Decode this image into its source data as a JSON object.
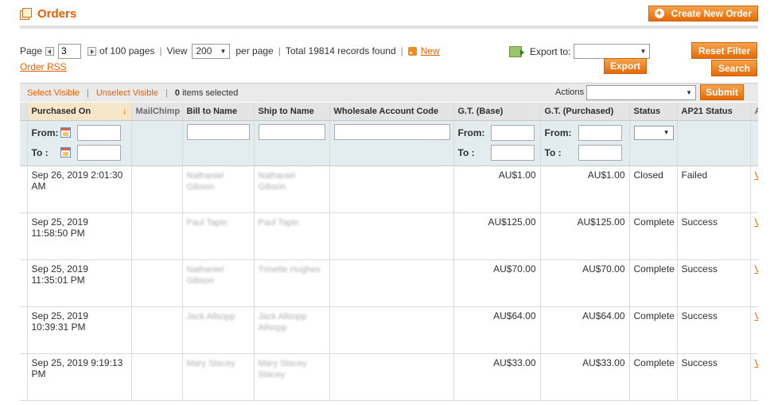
{
  "header": {
    "title": "Orders",
    "create_label": "Create New Order"
  },
  "pager": {
    "page_label": "Page",
    "page_value": "3",
    "of_pages": "of 100 pages",
    "view_label": "View",
    "per_page_value": "200",
    "per_page_label": "per page",
    "total": "Total 19814 records found",
    "rss_label": "New",
    "rss_label2": "Order RSS"
  },
  "export": {
    "label": "Export to:",
    "button": "Export"
  },
  "filter_buttons": {
    "reset": "Reset Filter",
    "search": "Search"
  },
  "massaction": {
    "select_visible": "Select Visible",
    "unselect_visible": "Unselect Visible",
    "items_count": "0",
    "items_selected": "items selected",
    "actions_label": "Actions",
    "submit": "Submit"
  },
  "columns": {
    "purchased_on": "Purchased On",
    "mailchimp": "MailChimp",
    "bill_to": "Bill to Name",
    "ship_to": "Ship to Name",
    "wholesale": "Wholesale Account Code",
    "gt_base": "G.T. (Base)",
    "gt_purchased": "G.T. (Purchased)",
    "status": "Status",
    "ap21": "AP21 Status",
    "action_short": "A"
  },
  "filters": {
    "from": "From:",
    "to": "To :"
  },
  "rows": [
    {
      "purchased_on": "Sep 26, 2019 2:01:30 AM",
      "bill_to": "Nathaniel Gibson",
      "ship_to": "Nathaniel Gibson",
      "gt_base": "AU$1.00",
      "gt_purchased": "AU$1.00",
      "status": "Closed",
      "ap21": "Failed",
      "view": "V"
    },
    {
      "purchased_on": "Sep 25, 2019 11:58:50 PM",
      "bill_to": "Paul Tapin",
      "ship_to": "Paul Tapin",
      "gt_base": "AU$125.00",
      "gt_purchased": "AU$125.00",
      "status": "Complete",
      "ap21": "Success",
      "view": "V"
    },
    {
      "purchased_on": "Sep 25, 2019 11:35:01 PM",
      "bill_to": "Nathaniel Gibson",
      "ship_to": "Trinette Hughes",
      "gt_base": "AU$70.00",
      "gt_purchased": "AU$70.00",
      "status": "Complete",
      "ap21": "Success",
      "view": "V"
    },
    {
      "purchased_on": "Sep 25, 2019 10:39:31 PM",
      "bill_to": "Jack Allsopp",
      "ship_to": "Jack Allsopp Allsopp",
      "gt_base": "AU$64.00",
      "gt_purchased": "AU$64.00",
      "status": "Complete",
      "ap21": "Success",
      "view": "V"
    },
    {
      "purchased_on": "Sep 25, 2019 9:19:13 PM",
      "bill_to": "Mary Stacey",
      "ship_to": "Mary Stacey Stacey",
      "gt_base": "AU$33.00",
      "gt_purchased": "AU$33.00",
      "status": "Complete",
      "ap21": "Success",
      "view": "V"
    }
  ],
  "colors": {
    "accent": "#eb5e00",
    "button_bg": "#e56a04",
    "filter_bg": "#e3edf0"
  }
}
